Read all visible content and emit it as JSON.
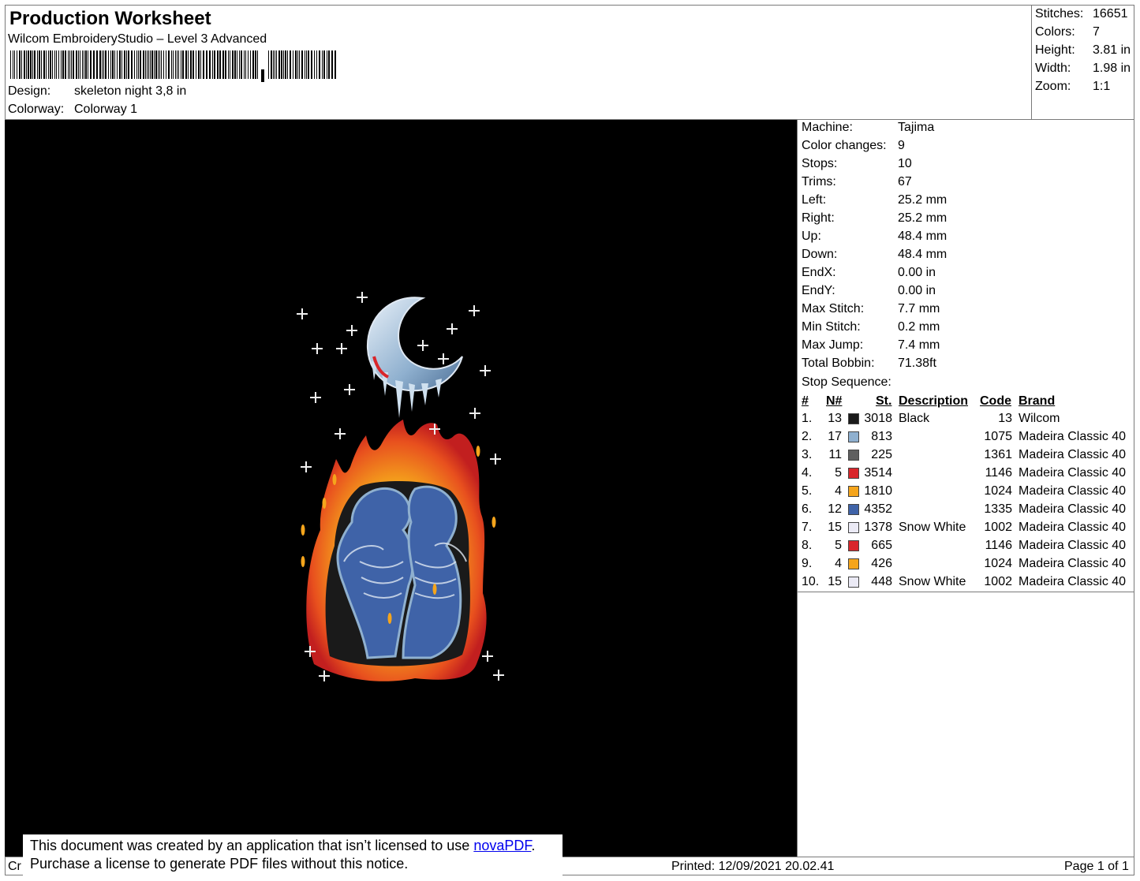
{
  "header": {
    "title": "Production Worksheet",
    "software": "Wilcom EmbroideryStudio – Level 3 Advanced",
    "design_label": "Design:",
    "design_value": "skeleton night 3,8 in",
    "colorway_label": "Colorway:",
    "colorway_value": "Colorway 1"
  },
  "stats": [
    {
      "label": "Stitches:",
      "value": "16651"
    },
    {
      "label": "Colors:",
      "value": "7"
    },
    {
      "label": "Height:",
      "value": "3.81 in"
    },
    {
      "label": "Width:",
      "value": "1.98 in"
    },
    {
      "label": "Zoom:",
      "value": "1:1"
    }
  ],
  "machine_info": [
    {
      "label": "Machine:",
      "value": "Tajima"
    },
    {
      "label": "Color changes:",
      "value": "9"
    },
    {
      "label": "Stops:",
      "value": "10"
    },
    {
      "label": "Trims:",
      "value": "67"
    },
    {
      "label": "Left:",
      "value": "25.2 mm"
    },
    {
      "label": "Right:",
      "value": "25.2 mm"
    },
    {
      "label": "Up:",
      "value": "48.4 mm"
    },
    {
      "label": "Down:",
      "value": "48.4 mm"
    },
    {
      "label": "EndX:",
      "value": "0.00 in"
    },
    {
      "label": "EndY:",
      "value": "0.00 in"
    },
    {
      "label": "Max Stitch:",
      "value": "7.7 mm"
    },
    {
      "label": "Min Stitch:",
      "value": "0.2 mm"
    },
    {
      "label": "Max Jump:",
      "value": "7.4 mm"
    },
    {
      "label": "Total Bobbin:",
      "value": "71.38ft"
    }
  ],
  "stop_sequence": {
    "title": "Stop Sequence:",
    "columns": {
      "index": "#",
      "needle": "N#",
      "stitches": "St.",
      "description": "Description",
      "code": "Code",
      "brand": "Brand"
    },
    "rows": [
      {
        "index": "1.",
        "needle": "13",
        "color": "#1a1a1a",
        "stitches": "3018",
        "description": "Black",
        "code": "13",
        "brand": "Wilcom"
      },
      {
        "index": "2.",
        "needle": "17",
        "color": "#8fb0cf",
        "stitches": "813",
        "description": "",
        "code": "1075",
        "brand": "Madeira Classic 40"
      },
      {
        "index": "3.",
        "needle": "11",
        "color": "#5f5f5f",
        "stitches": "225",
        "description": "",
        "code": "1361",
        "brand": "Madeira Classic 40"
      },
      {
        "index": "4.",
        "needle": "5",
        "color": "#d9262b",
        "stitches": "3514",
        "description": "",
        "code": "1146",
        "brand": "Madeira Classic 40"
      },
      {
        "index": "5.",
        "needle": "4",
        "color": "#f5a51c",
        "stitches": "1810",
        "description": "",
        "code": "1024",
        "brand": "Madeira Classic 40"
      },
      {
        "index": "6.",
        "needle": "12",
        "color": "#3f63a8",
        "stitches": "4352",
        "description": "",
        "code": "1335",
        "brand": "Madeira Classic 40"
      },
      {
        "index": "7.",
        "needle": "15",
        "color": "#ebeaf5",
        "stitches": "1378",
        "description": "Snow White",
        "code": "1002",
        "brand": "Madeira Classic 40"
      },
      {
        "index": "8.",
        "needle": "5",
        "color": "#d9262b",
        "stitches": "665",
        "description": "",
        "code": "1146",
        "brand": "Madeira Classic 40"
      },
      {
        "index": "9.",
        "needle": "4",
        "color": "#f5a51c",
        "stitches": "426",
        "description": "",
        "code": "1024",
        "brand": "Madeira Classic 40"
      },
      {
        "index": "10.",
        "needle": "15",
        "color": "#ebeaf5",
        "stitches": "448",
        "description": "Snow White",
        "code": "1002",
        "brand": "Madeira Classic 40"
      }
    ]
  },
  "footer": {
    "left": "Cr",
    "printed": "Printed: 12/09/2021 20.02.41",
    "page": "Page 1 of 1"
  },
  "notice": {
    "line1_prefix": "This document was created by an application that isn’t licensed to use ",
    "link": "novaPDF",
    "line1_suffix": ".",
    "line2": "Purchase a license to generate PDF files without this notice."
  }
}
